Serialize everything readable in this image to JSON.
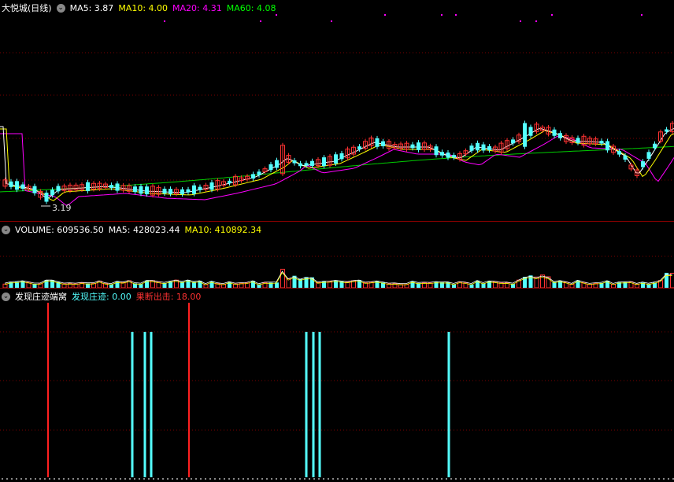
{
  "price_panel": {
    "title": "大悦城(日线)",
    "ma5_label": "MA5: 3.87",
    "ma10_label": "MA10: 4.00",
    "ma20_label": "MA20: 4.31",
    "ma60_label": "MA60: 4.08",
    "low_marker": "3.19",
    "colors": {
      "ma5": "#ffffff",
      "ma10": "#ffff00",
      "ma20": "#ff00ff",
      "ma60": "#00cc00",
      "up": "#ff3232",
      "down": "#54ffff"
    }
  },
  "volume_panel": {
    "label": "VOLUME: 609536.50",
    "ma5_label": "MA5: 428023.44",
    "ma10_label": "MA10: 410892.34"
  },
  "indicator_panel": {
    "name": "发现庄迹端窝",
    "trace_label": "发现庄迹: 0.00",
    "exit_label": "果断出击: 18.00"
  }
}
